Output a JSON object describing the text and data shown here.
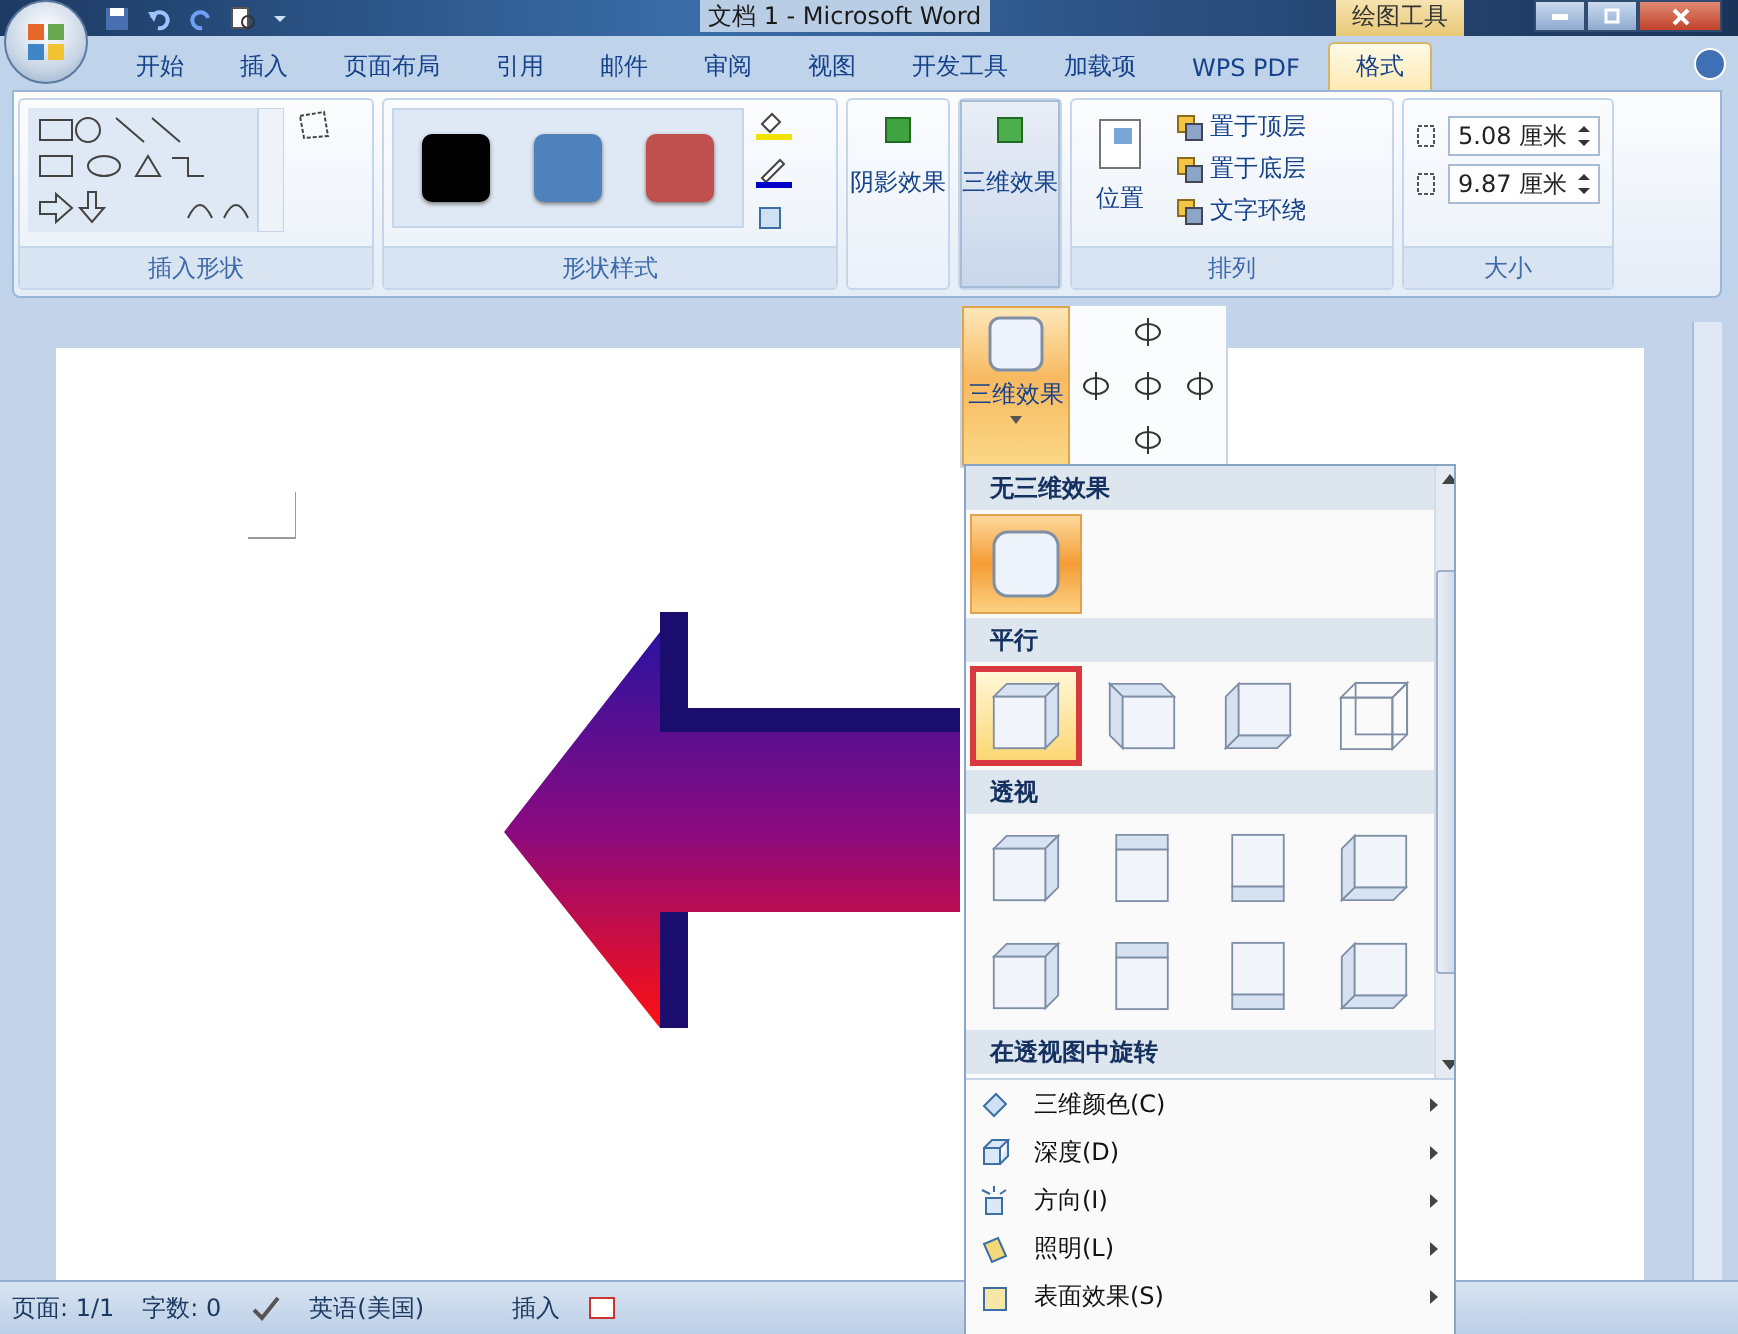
{
  "title_bar": {
    "title": "文档 1 - Microsoft Word",
    "context_tab": "绘图工具"
  },
  "tabs": [
    {
      "label": "开始",
      "selected": false
    },
    {
      "label": "插入",
      "selected": false
    },
    {
      "label": "页面布局",
      "selected": false
    },
    {
      "label": "引用",
      "selected": false
    },
    {
      "label": "邮件",
      "selected": false
    },
    {
      "label": "审阅",
      "selected": false
    },
    {
      "label": "视图",
      "selected": false
    },
    {
      "label": "开发工具",
      "selected": false
    },
    {
      "label": "加载项",
      "selected": false
    },
    {
      "label": "WPS PDF",
      "selected": false
    },
    {
      "label": "格式",
      "selected": true
    }
  ],
  "insert_shapes": {
    "label": "插入形状"
  },
  "shape_styles": {
    "label": "形状样式",
    "swatches": [
      {
        "color": "#000000"
      },
      {
        "color": "#4f81bd"
      },
      {
        "color": "#c0504d"
      }
    ]
  },
  "shadow_button": {
    "label": "阴影效果",
    "selected": false
  },
  "threed_button": {
    "label": "三维效果",
    "selected": true
  },
  "arrange": {
    "label": "排列",
    "position": "位置",
    "items": [
      "置于顶层",
      "置于底层",
      "文字环绕"
    ]
  },
  "size": {
    "label": "大小",
    "height": "5.08 厘米",
    "width": "9.87 厘米"
  },
  "popup": {
    "button": "三维效果",
    "sections": [
      {
        "title": "无三维效果",
        "items": [
          {
            "kind": "flat",
            "selected": true,
            "hovered": false
          }
        ]
      },
      {
        "title": "平行",
        "items": [
          {
            "kind": "upright",
            "selected": false,
            "hovered": true
          },
          {
            "kind": "upleft",
            "selected": false,
            "hovered": false
          },
          {
            "kind": "downleft",
            "selected": false,
            "hovered": false
          },
          {
            "kind": "wire",
            "selected": false,
            "hovered": false
          }
        ]
      },
      {
        "title": "透视",
        "items": [
          {
            "kind": "upright",
            "selected": false,
            "hovered": false
          },
          {
            "kind": "up",
            "selected": false,
            "hovered": false
          },
          {
            "kind": "down",
            "selected": false,
            "hovered": false
          },
          {
            "kind": "downleft",
            "selected": false,
            "hovered": false
          },
          {
            "kind": "upright",
            "selected": false,
            "hovered": false
          },
          {
            "kind": "up",
            "selected": false,
            "hovered": false
          },
          {
            "kind": "down",
            "selected": false,
            "hovered": false
          },
          {
            "kind": "downleft",
            "selected": false,
            "hovered": false
          }
        ]
      },
      {
        "title": "在透视图中旋转"
      }
    ],
    "menu": [
      {
        "label": "三维颜色(C)",
        "kind": "color"
      },
      {
        "label": "深度(D)",
        "kind": "depth"
      },
      {
        "label": "方向(I)",
        "kind": "direction"
      },
      {
        "label": "照明(L)",
        "kind": "lighting"
      },
      {
        "label": "表面效果(S)",
        "kind": "surface"
      }
    ]
  },
  "status_bar": {
    "page": "页面: 1/1",
    "words": "字数: 0",
    "language": "英语(美国)",
    "mode": "插入"
  }
}
